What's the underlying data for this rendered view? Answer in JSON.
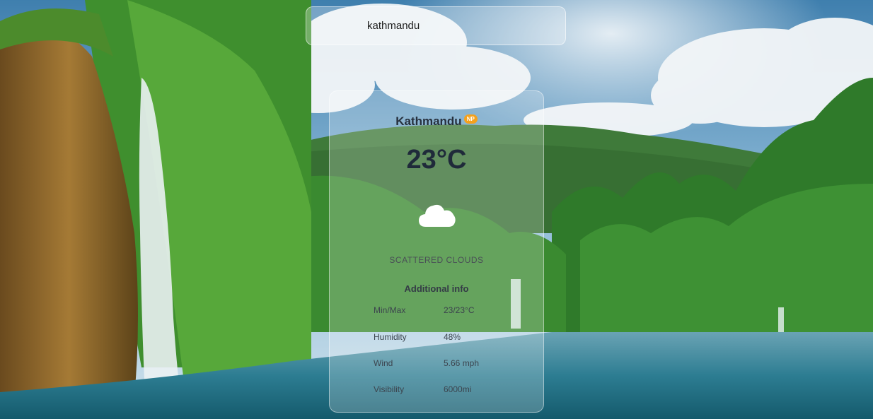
{
  "search": {
    "value": "kathmandu"
  },
  "weather": {
    "city": "Kathmandu",
    "country_code": "NP",
    "temperature": "23°C",
    "icon": "cloud-icon",
    "description": "SCATTERED CLOUDS"
  },
  "additional_info": {
    "title": "Additional info",
    "rows": [
      {
        "label": "Min/Max",
        "value": "23/23°C"
      },
      {
        "label": "Humidity",
        "value": "48%"
      },
      {
        "label": "Wind",
        "value": "5.66 mph"
      },
      {
        "label": "Visibility",
        "value": "6000mi"
      }
    ]
  },
  "colors": {
    "badge": "#f4a11d",
    "text_dark": "#1f2a3a"
  }
}
